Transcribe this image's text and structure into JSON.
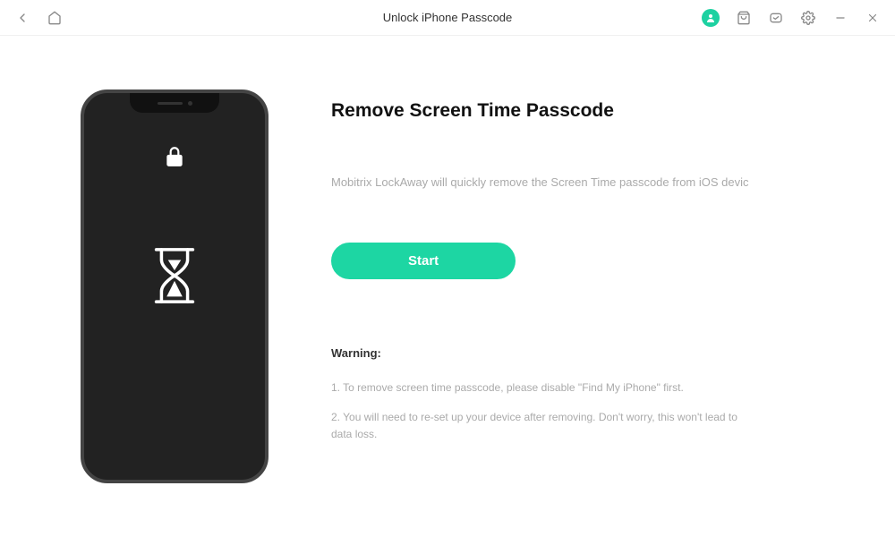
{
  "titlebar": {
    "title": "Unlock iPhone Passcode"
  },
  "main": {
    "heading": "Remove Screen Time Passcode",
    "description": "Mobitrix LockAway will quickly remove the Screen Time passcode from iOS devic",
    "start_label": "Start",
    "warning_title": "Warning:",
    "warning_items": [
      "1. To remove screen time passcode, please disable \"Find My iPhone\" first.",
      "2. You will need to re-set up your device after removing. Don't worry, this won't lead to data loss."
    ]
  },
  "colors": {
    "accent": "#1dd6a3"
  }
}
